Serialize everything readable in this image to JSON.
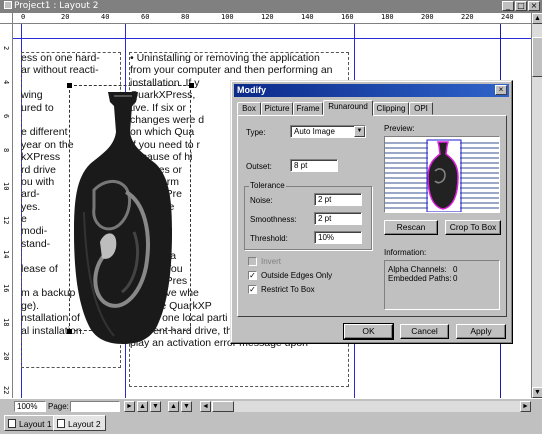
{
  "window": {
    "title": "Project1 : Layout 2",
    "minimize": "_",
    "maximize": "□",
    "close": "×"
  },
  "ruler": {
    "top_ticks": [
      "0",
      "20",
      "40",
      "60",
      "80",
      "100",
      "120",
      "140",
      "160",
      "180",
      "200",
      "220",
      "240"
    ],
    "left_ticks": [
      "2",
      "4",
      "6",
      "8",
      "10",
      "12",
      "14",
      "16",
      "18",
      "20",
      "22"
    ]
  },
  "document": {
    "col1_lines": [
      "ess on one hard-",
      "ar without reacti-",
      "",
      "wing",
      "ured to",
      "",
      "e different",
      " year on the",
      "kXPress",
      "rd drive",
      "ou with",
      "ard-",
      "yes.",
      "e",
      "modi-",
      "stand-",
      "",
      "lease of",
      "",
      "m a backup",
      "ge).",
      "nstallation of",
      "al installation."
    ],
    "col2_lines": [
      "• Uninstalling or removing the application",
      "from your computer and then performing an",
      "installation. If y",
      "QuarkXPress,",
      "tive. If six or",
      "changes were d",
      "on which Qua",
      "If you need to r",
      "because of hi",
      "changes or",
      "tion inform",
      "QuarkXPre",
      "this is the",
      "reinstall",
      "QuarkXP",
      "to reinst",
      "become a",
      "NOTE: You",
      "QuarkXPres",
      "hard drive whe",
      "activate QuarkXP",
      "it from one local parti",
      "different hard drive, the application will dis-",
      "play an activation error message upon"
    ]
  },
  "statusbar": {
    "zoom": "100%",
    "page_label": "Page:",
    "page_value": "",
    "next": "►",
    "prev": "◄",
    "prev_btn": "▲",
    "next_btn": "▼"
  },
  "layout_tabs": [
    {
      "label": "Layout 1"
    },
    {
      "label": "Layout 2"
    }
  ],
  "dialog": {
    "title": "Modify",
    "close": "×",
    "tabs": [
      "Box",
      "Picture",
      "Frame",
      "Runaround",
      "Clipping",
      "OPI"
    ],
    "active_tab": "Runaround",
    "type_label": "Type:",
    "type_value": "Auto Image",
    "outset_label": "Outset:",
    "outset_value": "8 pt",
    "tolerance_label": "Tolerance",
    "noise_label": "Noise:",
    "noise_value": "2 pt",
    "smoothness_label": "Smoothness:",
    "smoothness_value": "2 pt",
    "threshold_label": "Threshold:",
    "threshold_value": "10%",
    "invert_label": "Invert",
    "invert_checked": false,
    "outside_edges_label": "Outside Edges Only",
    "outside_edges_checked": true,
    "restrict_label": "Restrict To Box",
    "restrict_checked": true,
    "preview_label": "Preview:",
    "rescan_label": "Rescan",
    "crop_label": "Crop To Box",
    "information_label": "Information:",
    "alpha_label": "Alpha Channels:",
    "alpha_value": "0",
    "embedded_label": "Embedded Paths:",
    "embedded_value": "0",
    "ok_label": "OK",
    "cancel_label": "Cancel",
    "apply_label": "Apply",
    "check_mark": "✓"
  },
  "colors": {
    "title_active": "#0b2a8a",
    "guide_blue": "#2b2bd6",
    "runaround_magenta": "#e020e0"
  }
}
